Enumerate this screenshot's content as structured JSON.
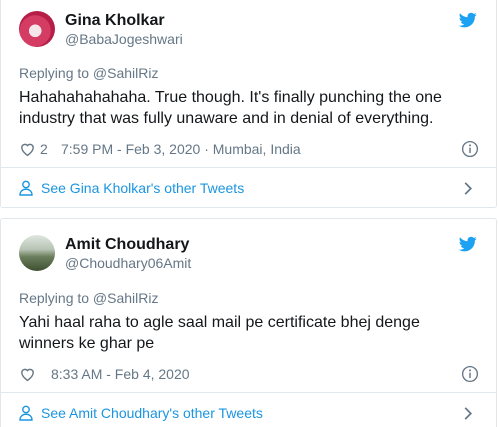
{
  "tweets": [
    {
      "display_name": "Gina Kholkar",
      "handle": "@BabaJogeshwari",
      "replying_to": "Replying to @SahilRiz",
      "text": "Hahahahahahaha. True though. It's finally punching the one industry that was fully unaware and in denial of everything.",
      "likes": "2",
      "timestamp": "7:59 PM - Feb 3, 2020 · Mumbai, India",
      "other_tweets_link": "See Gina Kholkar's other Tweets"
    },
    {
      "display_name": "Amit Choudhary",
      "handle": "@Choudhary06Amit",
      "replying_to": "Replying to @SahilRiz",
      "text": "Yahi haal raha to agle saal mail pe certificate bhej denge winners ke ghar pe",
      "likes": "",
      "timestamp": "8:33 AM - Feb 4, 2020",
      "other_tweets_link": "See Amit Choudhary's other Tweets"
    }
  ],
  "colors": {
    "link_blue": "#1b95e0",
    "muted_gray": "#657786",
    "border": "#e1e8ed",
    "twitter_blue": "#1da1f2"
  },
  "icons": [
    "twitter-bird-icon",
    "heart-icon",
    "info-icon",
    "person-icon",
    "chevron-right-icon"
  ]
}
